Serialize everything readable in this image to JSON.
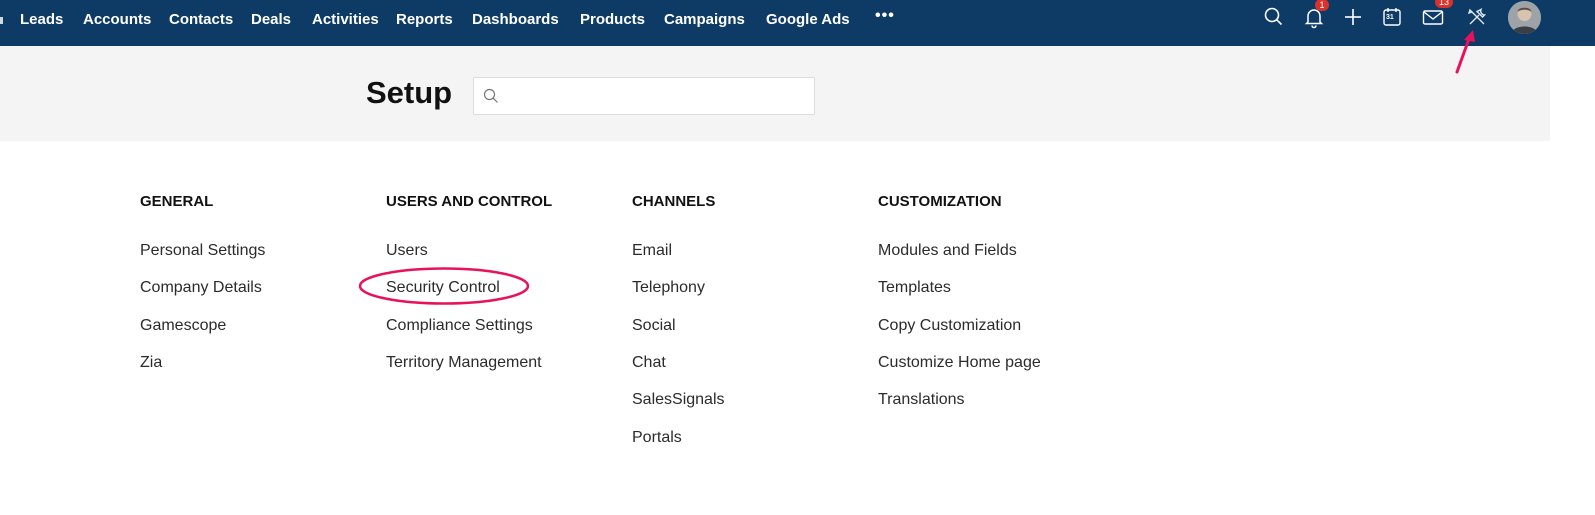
{
  "nav": {
    "tabs": [
      "Leads",
      "Accounts",
      "Contacts",
      "Deals",
      "Activities",
      "Reports",
      "Dashboards",
      "Products",
      "Campaigns",
      "Google Ads"
    ],
    "more_label": "•••",
    "icons": [
      "search-icon",
      "bell-icon",
      "plus-icon",
      "calendar-icon",
      "mail-icon",
      "setup-tools-icon"
    ],
    "notification_count": "1",
    "mail_count": "13",
    "calendar_day": "31"
  },
  "setup": {
    "title": "Setup",
    "search_placeholder": ""
  },
  "columns": [
    {
      "heading": "GENERAL",
      "items": [
        "Personal Settings",
        "Company Details",
        "Gamescope",
        "Zia"
      ]
    },
    {
      "heading": "USERS AND CONTROL",
      "items": [
        "Users",
        "Security Control",
        "Compliance Settings",
        "Territory Management"
      ]
    },
    {
      "heading": "CHANNELS",
      "items": [
        "Email",
        "Telephony",
        "Social",
        "Chat",
        "SalesSignals",
        "Portals"
      ]
    },
    {
      "heading": "CUSTOMIZATION",
      "items": [
        "Modules and Fields",
        "Templates",
        "Copy Customization",
        "Customize Home page",
        "Translations"
      ]
    }
  ],
  "colors": {
    "nav_bg": "#0d3b66",
    "band_bg": "#f4f4f4",
    "badge": "#d9312b",
    "annotation": "#e8125c"
  }
}
